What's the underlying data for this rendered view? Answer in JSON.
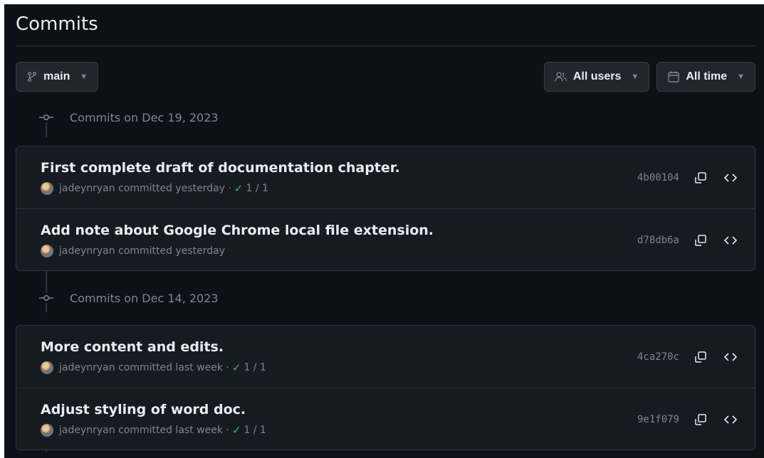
{
  "page": {
    "title": "Commits"
  },
  "toolbar": {
    "branch_label": "main",
    "users_label": "All users",
    "time_label": "All time"
  },
  "groups": [
    {
      "header": "Commits on Dec 19, 2023",
      "commits": [
        {
          "title": "First complete draft of documentation chapter.",
          "author": "jadeynryan",
          "when": "committed yesterday",
          "check": "1 / 1",
          "sha": "4b00104"
        },
        {
          "title": "Add note about Google Chrome local file extension.",
          "author": "jadeynryan",
          "when": "committed yesterday",
          "check": "",
          "sha": "d78db6a"
        }
      ]
    },
    {
      "header": "Commits on Dec 14, 2023",
      "commits": [
        {
          "title": "More content and edits.",
          "author": "jadeynryan",
          "when": "committed last week",
          "check": "1 / 1",
          "sha": "4ca270c"
        },
        {
          "title": "Adjust styling of word doc.",
          "author": "jadeynryan",
          "when": "committed last week",
          "check": "1 / 1",
          "sha": "9e1f079"
        }
      ]
    }
  ],
  "colors": {
    "background": "#0d1117",
    "surface": "#161b22",
    "border": "#30363d",
    "muted": "#7d8590",
    "success": "#3fb950"
  }
}
